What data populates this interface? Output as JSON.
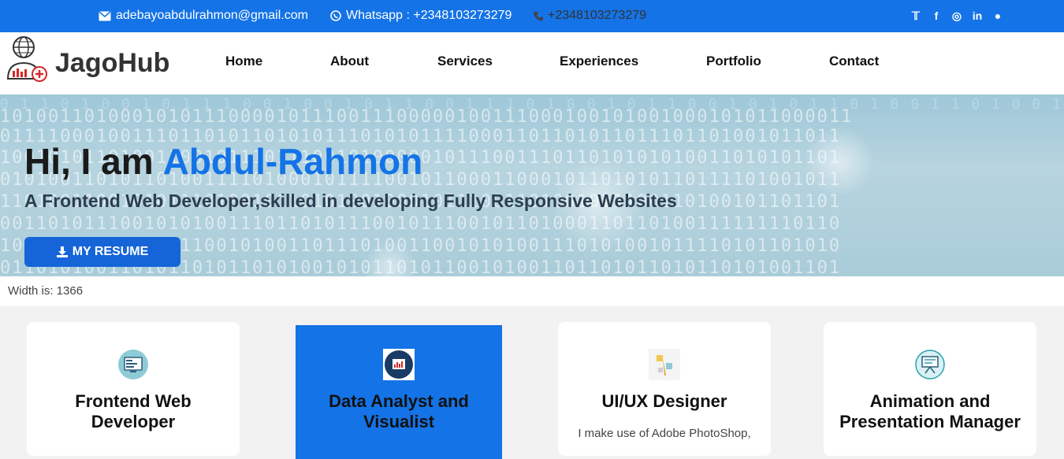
{
  "topbar": {
    "email": "adebayoabdulrahmon@gmail.com",
    "whatsapp": "Whatsapp : +2348103273279",
    "phone": "+2348103273279",
    "socials": [
      "twitter-icon",
      "facebook-icon",
      "instagram-icon",
      "linkedin-icon",
      "github-icon"
    ]
  },
  "nav": {
    "brand": "JagoHub",
    "items": [
      "Home",
      "About",
      "Services",
      "Experiences",
      "Portfolio",
      "Contact"
    ]
  },
  "hero": {
    "greeting": "Hi, I am",
    "name": "Abdul-Rahmon",
    "subtitle": "A Frontend Web Developer,skilled in developing Fully Responsive Websites",
    "resume_label": "MY RESUME"
  },
  "width_text": "Width is: 1366",
  "cards": [
    {
      "title": "Frontend Web Developer",
      "desc": "",
      "icon": "code-screen-icon"
    },
    {
      "title": "Data Analyst and Visualist",
      "desc": "",
      "icon": "chart-icon"
    },
    {
      "title": "UI/UX Designer",
      "desc": "I make use of Adobe PhotoShop,",
      "icon": "design-tools-icon"
    },
    {
      "title": "Animation and Presentation Manager",
      "desc": "",
      "icon": "presentation-board-icon"
    }
  ],
  "colors": {
    "primary": "#1473e6",
    "text_dark": "#1a1a1a",
    "subtitle": "#2c3e50"
  }
}
